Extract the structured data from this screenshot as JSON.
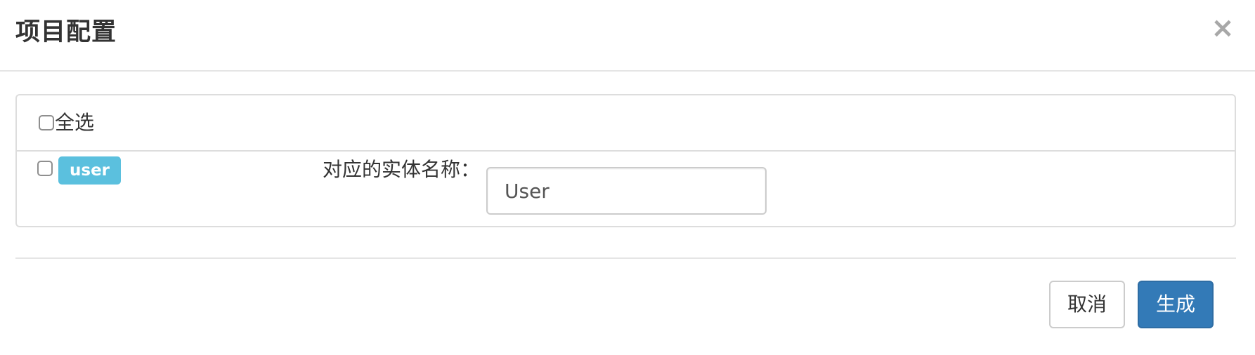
{
  "dialog": {
    "title": "项目配置",
    "close_symbol": "×",
    "close_icon": "close-icon"
  },
  "panel": {
    "select_all_label": "全选",
    "select_all_checked": false,
    "rows": [
      {
        "checked": false,
        "table_name": "user",
        "table_badge_color": "#5bc0de",
        "entity_label": "对应的实体名称：",
        "entity_value": "User"
      }
    ]
  },
  "footer": {
    "cancel_label": "取消",
    "generate_label": "生成",
    "primary_color": "#337ab7"
  }
}
